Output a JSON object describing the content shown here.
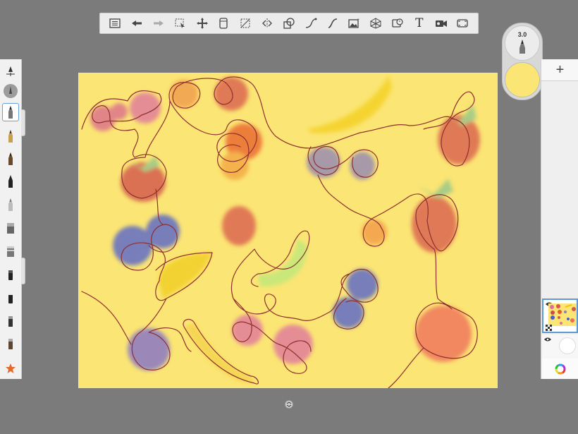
{
  "toolbar": {
    "tools": [
      {
        "icon": "list-icon"
      },
      {
        "icon": "undo-icon"
      },
      {
        "icon": "redo-icon"
      },
      {
        "icon": "select-icon"
      },
      {
        "icon": "transform-icon"
      },
      {
        "icon": "ruler-icon"
      },
      {
        "icon": "perspective-icon"
      },
      {
        "icon": "symmetry-icon"
      },
      {
        "icon": "shapes-icon"
      },
      {
        "icon": "curve-icon"
      },
      {
        "icon": "french-curve-icon"
      },
      {
        "icon": "import-image-icon"
      },
      {
        "icon": "perspective-grid-icon"
      },
      {
        "icon": "time-lapse-icon"
      },
      {
        "icon": "text-icon",
        "label": "T"
      },
      {
        "icon": "video-icon"
      },
      {
        "icon": "fullscreen-icon"
      }
    ]
  },
  "puck": {
    "brush_size": "3.0",
    "color": "#fbe574"
  },
  "right_panel": {
    "add_label": "+"
  },
  "canvas": {
    "background": "#fbe574",
    "stroke_color": "#8e2f2f"
  },
  "brushes": [
    {
      "icon": "brush-settings-icon"
    },
    {
      "icon": "brush-preview-icon"
    },
    {
      "icon": "pencil-icon",
      "selected": true
    },
    {
      "icon": "pen-icon"
    },
    {
      "icon": "ink-pen-icon"
    },
    {
      "icon": "marker-icon"
    },
    {
      "icon": "airbrush-icon"
    },
    {
      "icon": "paint-brush-icon"
    },
    {
      "icon": "wide-brush-icon"
    },
    {
      "icon": "smudge-icon"
    },
    {
      "icon": "eraser-icon"
    },
    {
      "icon": "watercolor-icon"
    },
    {
      "icon": "fill-icon"
    },
    {
      "icon": "favorites-star-icon"
    }
  ]
}
